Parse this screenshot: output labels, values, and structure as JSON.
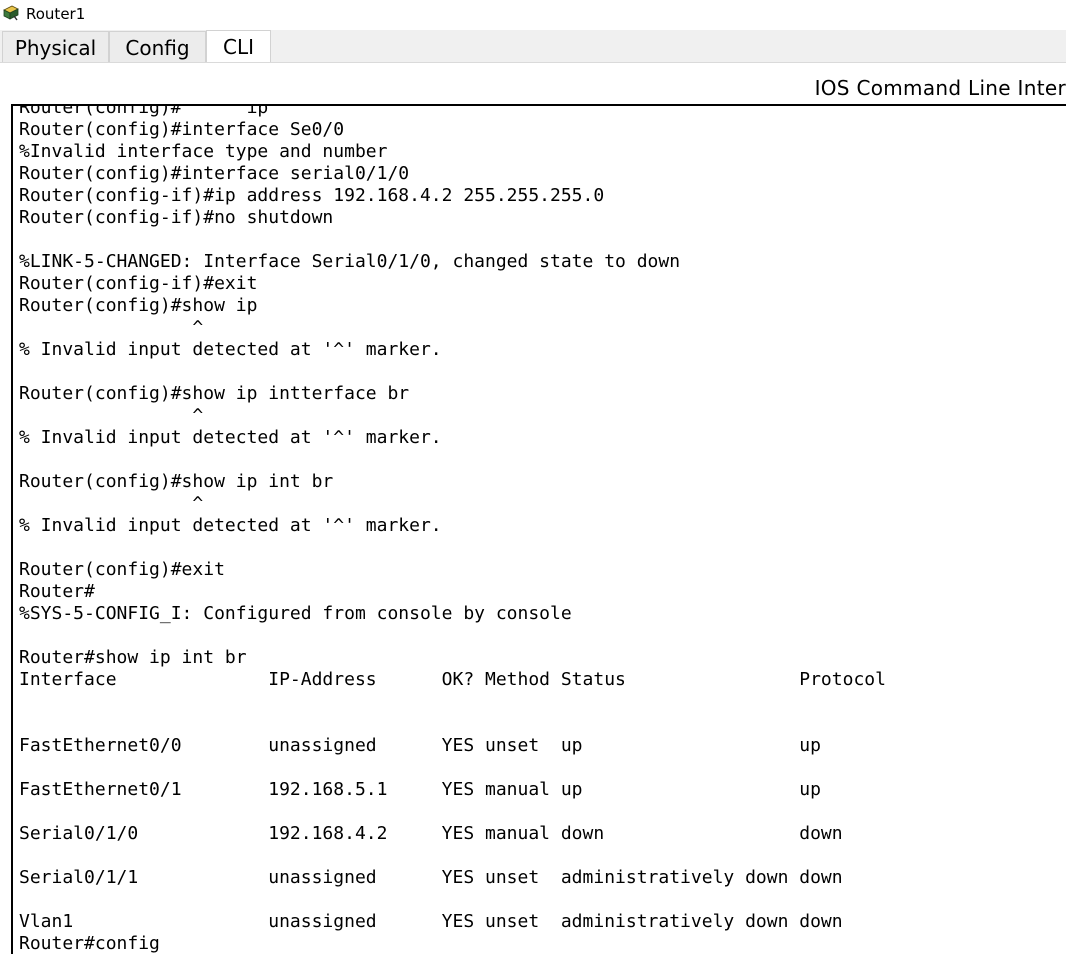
{
  "window": {
    "title": "Router1",
    "icon": "router-device-icon"
  },
  "tabs": [
    {
      "label": "Physical",
      "active": false
    },
    {
      "label": "Config",
      "active": false
    },
    {
      "label": "CLI",
      "active": true
    }
  ],
  "cli": {
    "header": "IOS Command Line Inter",
    "lines": [
      "Router(config)#      ip",
      "Router(config)#interface Se0/0",
      "%Invalid interface type and number",
      "Router(config)#interface serial0/1/0",
      "Router(config-if)#ip address 192.168.4.2 255.255.255.0",
      "Router(config-if)#no shutdown",
      "",
      "%LINK-5-CHANGED: Interface Serial0/1/0, changed state to down",
      "Router(config-if)#exit",
      "Router(config)#show ip",
      "                ^",
      "% Invalid input detected at '^' marker.",
      "",
      "Router(config)#show ip intterface br",
      "                ^",
      "% Invalid input detected at '^' marker.",
      "",
      "Router(config)#show ip int br",
      "                ^",
      "% Invalid input detected at '^' marker.",
      "",
      "Router(config)#exit",
      "Router#",
      "%SYS-5-CONFIG_I: Configured from console by console",
      "",
      "Router#show ip int br",
      "Interface              IP-Address      OK? Method Status                Protocol",
      "",
      "",
      "FastEthernet0/0        unassigned      YES unset  up                    up",
      "",
      "FastEthernet0/1        192.168.5.1     YES manual up                    up",
      "",
      "Serial0/1/0            192.168.4.2     YES manual down                  down",
      "",
      "Serial0/1/1            unassigned      YES unset  administratively down down",
      "",
      "Vlan1                  unassigned      YES unset  administratively down down",
      "Router#config"
    ]
  }
}
